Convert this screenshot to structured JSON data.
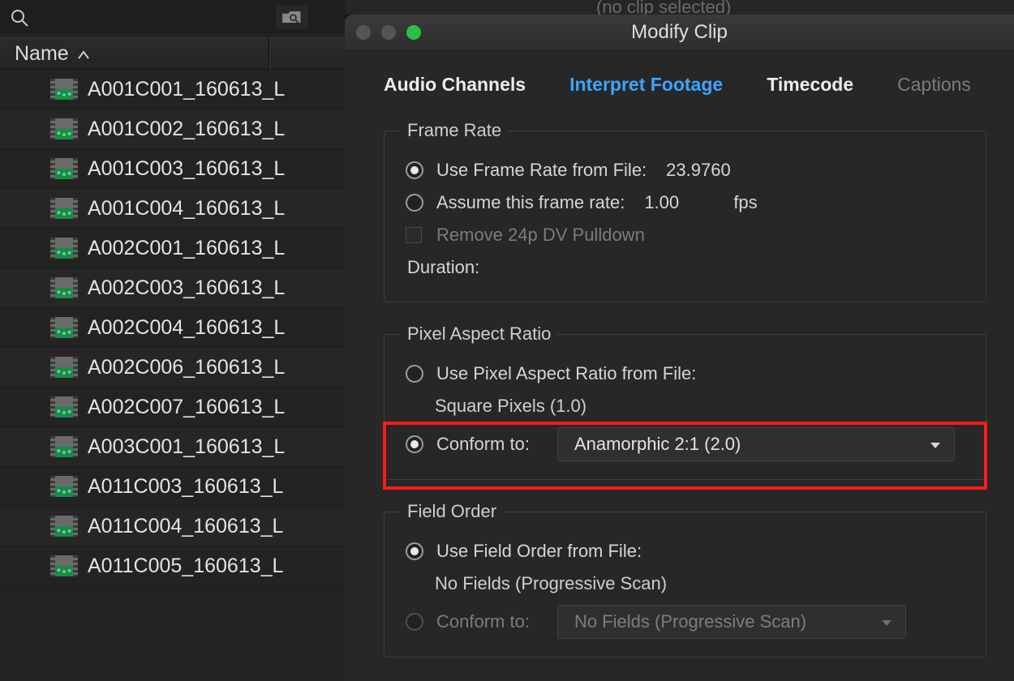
{
  "bin": {
    "header_label": "Name",
    "clips": [
      "A001C001_160613_L",
      "A001C002_160613_L",
      "A001C003_160613_L",
      "A001C004_160613_L",
      "A002C001_160613_L",
      "A002C003_160613_L",
      "A002C004_160613_L",
      "A002C006_160613_L",
      "A002C007_160613_L",
      "A003C001_160613_L",
      "A011C003_160613_L",
      "A011C004_160613_L",
      "A011C005_160613_L"
    ]
  },
  "banner": {
    "no_clip": "(no clip selected)"
  },
  "dialog": {
    "title": "Modify Clip",
    "tabs": {
      "audio": "Audio Channels",
      "interpret": "Interpret Footage",
      "timecode": "Timecode",
      "captions": "Captions"
    },
    "frame_rate": {
      "legend": "Frame Rate",
      "use_file_label": "Use Frame Rate from File:",
      "use_file_value": "23.9760",
      "assume_label": "Assume this frame rate:",
      "assume_value": "1.00",
      "assume_unit": "fps",
      "remove_pulldown": "Remove 24p DV Pulldown",
      "duration_label": "Duration:"
    },
    "par": {
      "legend": "Pixel Aspect Ratio",
      "use_file_label": "Use Pixel Aspect Ratio from File:",
      "use_file_value": "Square Pixels (1.0)",
      "conform_label": "Conform to:",
      "conform_value": "Anamorphic 2:1 (2.0)"
    },
    "field_order": {
      "legend": "Field Order",
      "use_file_label": "Use Field Order from File:",
      "use_file_value": "No Fields (Progressive Scan)",
      "conform_label": "Conform to:",
      "conform_value": "No Fields (Progressive Scan)"
    }
  }
}
